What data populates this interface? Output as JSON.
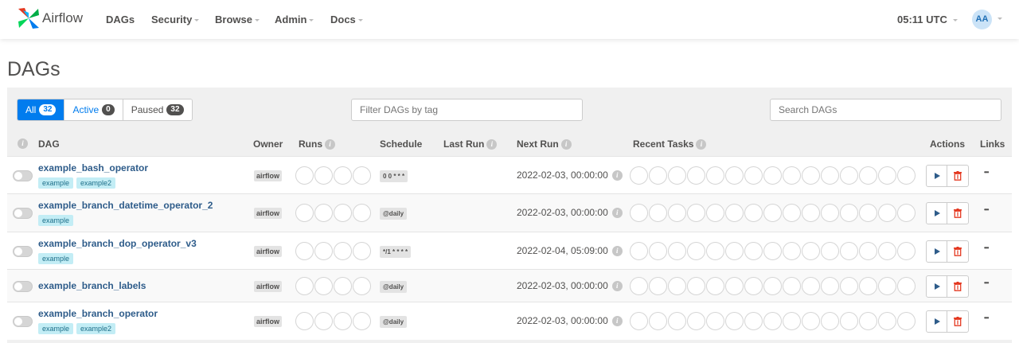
{
  "brand": {
    "name": "Airflow"
  },
  "nav": {
    "items": [
      {
        "label": "DAGs",
        "has_caret": false
      },
      {
        "label": "Security",
        "has_caret": true
      },
      {
        "label": "Browse",
        "has_caret": true
      },
      {
        "label": "Admin",
        "has_caret": true
      },
      {
        "label": "Docs",
        "has_caret": true
      }
    ],
    "clock": "05:11 UTC",
    "avatar": "AA"
  },
  "page": {
    "title": "DAGs"
  },
  "filters": {
    "status": [
      {
        "label": "All",
        "count": "32"
      },
      {
        "label": "Active",
        "count": "0"
      },
      {
        "label": "Paused",
        "count": "32"
      }
    ],
    "tag_placeholder": "Filter DAGs by tag",
    "search_placeholder": "Search DAGs"
  },
  "table": {
    "headers": {
      "dag": "DAG",
      "owner": "Owner",
      "runs": "Runs",
      "schedule": "Schedule",
      "last_run": "Last Run",
      "next_run": "Next Run",
      "recent_tasks": "Recent Tasks",
      "actions": "Actions",
      "links": "Links"
    },
    "rows": [
      {
        "name": "example_bash_operator",
        "tags": [
          "example",
          "example2"
        ],
        "owner": "airflow",
        "schedule": "0 0 * * *",
        "next_run": "2022-02-03, 00:00:00"
      },
      {
        "name": "example_branch_datetime_operator_2",
        "tags": [
          "example"
        ],
        "owner": "airflow",
        "schedule": "@daily",
        "next_run": "2022-02-03, 00:00:00"
      },
      {
        "name": "example_branch_dop_operator_v3",
        "tags": [
          "example"
        ],
        "owner": "airflow",
        "schedule": "*/1 * * * *",
        "next_run": "2022-02-04, 05:09:00"
      },
      {
        "name": "example_branch_labels",
        "tags": [],
        "owner": "airflow",
        "schedule": "@daily",
        "next_run": "2022-02-03, 00:00:00"
      },
      {
        "name": "example_branch_operator",
        "tags": [
          "example",
          "example2"
        ],
        "owner": "airflow",
        "schedule": "@daily",
        "next_run": "2022-02-03, 00:00:00"
      }
    ]
  },
  "colors": {
    "primary": "#017cee",
    "link": "#2e5c8a",
    "tag_bg": "#c3edf5",
    "delete": "#e43921"
  },
  "icons": {
    "trigger": "play-icon",
    "delete": "trash-icon",
    "links": "ellipsis-icon",
    "info": "info-icon"
  }
}
